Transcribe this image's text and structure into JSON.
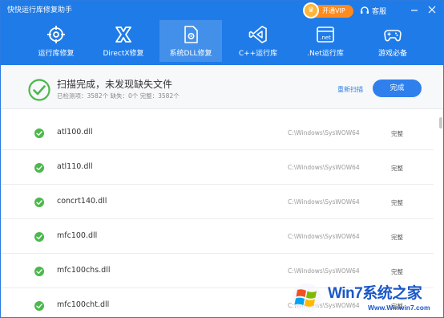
{
  "app": {
    "title": "快快运行库修复助手",
    "vip_label": "开通VIP",
    "service_label": "客服"
  },
  "tabs": [
    {
      "label": "运行库修复",
      "icon": "target-icon",
      "active": false
    },
    {
      "label": "DirectX修复",
      "icon": "directx-icon",
      "active": false
    },
    {
      "label": "系统DLL修复",
      "icon": "dll-gear-icon",
      "active": true
    },
    {
      "label": "C++运行库",
      "icon": "visual-studio-icon",
      "active": false
    },
    {
      "label": ".Net运行库",
      "icon": "dotnet-icon",
      "active": false
    },
    {
      "label": "游戏必备",
      "icon": "gamepad-icon",
      "active": false
    }
  ],
  "status": {
    "title": "扫描完成，未发现缺失文件",
    "summary": "已检测项：3582个  缺失：0个  完整：3582个",
    "rescan_label": "重新扫描",
    "done_label": "完成"
  },
  "files": [
    {
      "name": "atl100.dll",
      "path": "C:\\Windows\\SysWOW64",
      "state": "完整"
    },
    {
      "name": "atl110.dll",
      "path": "C:\\Windows\\SysWOW64",
      "state": "完整"
    },
    {
      "name": "concrt140.dll",
      "path": "C:\\Windows\\SysWOW64",
      "state": "完整"
    },
    {
      "name": "mfc100.dll",
      "path": "C:\\Windows\\SysWOW64",
      "state": "完整"
    },
    {
      "name": "mfc100chs.dll",
      "path": "C:\\Windows\\SysWOW64",
      "state": "完整"
    },
    {
      "name": "mfc100cht.dll",
      "path": "C:\\Windows\\SysWOW64",
      "state": "完整"
    }
  ],
  "watermark": {
    "text": "Win7系统之家",
    "url": "Www.Winwin7.com"
  },
  "colors": {
    "brand_blue": "#1f7be8",
    "ok_green": "#4cb84c",
    "vip_orange": "#ff8a1d"
  }
}
